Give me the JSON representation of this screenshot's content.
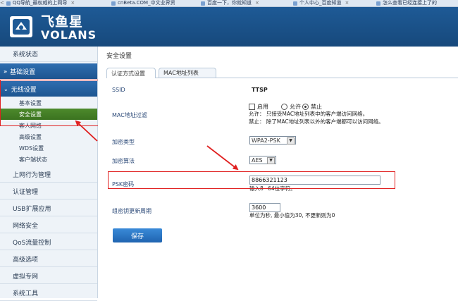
{
  "browser": {
    "tabs": [
      {
        "label": "QQ导航_最权威的上网导"
      },
      {
        "label": "cnBeta.COM_中文业界资"
      },
      {
        "label": "百度一下，你就知道"
      },
      {
        "label": "个人中心_百度知道"
      },
      {
        "label": "怎么查看已经连接上了的"
      }
    ]
  },
  "brand": {
    "name_cn": "飞鱼星",
    "name_en": "VOLANS"
  },
  "sidebar": {
    "status": "系统状态",
    "basic": "基础设置",
    "wireless": "无线设置",
    "wireless_items": [
      "基本设置",
      "安全设置",
      "客人网络",
      "高级设置",
      "WDS设置",
      "客户端状态"
    ],
    "other_items": [
      "上网行为管理",
      "认证管理",
      "USB扩展应用",
      "网络安全",
      "QoS流量控制",
      "高级选项",
      "虚拟专网",
      "系统工具"
    ]
  },
  "main": {
    "title": "安全设置",
    "tabs": [
      "认证方式设置",
      "MAC地址列表"
    ],
    "ssid_label": "SSID",
    "ssid_value": "TTSP",
    "mac_label": "MAC地址过滤",
    "mac_enable": "启用",
    "mac_allow": "允许",
    "mac_deny": "禁止",
    "mac_note1": "允许： 只接受MAC地址列表中的客户端访问网络。",
    "mac_note2": "禁止： 除了MAC地址列表以外的客户端都可以访问网络。",
    "enc_type_label": "加密类型",
    "enc_type_value": "WPA2-PSK",
    "enc_algo_label": "加密算法",
    "enc_algo_value": "AES",
    "psk_label": "PSK密码",
    "psk_value": "8866321123",
    "psk_hint": "输入8~64位字符。",
    "rekey_label": "组密钥更新周期",
    "rekey_value": "3600",
    "rekey_hint": "单位为秒, 最小值为30, 不更新则为0",
    "save": "保存"
  },
  "colors": {
    "header": "#1e5a96",
    "active_nav": "#3b7320",
    "annotation": "#e02020"
  }
}
